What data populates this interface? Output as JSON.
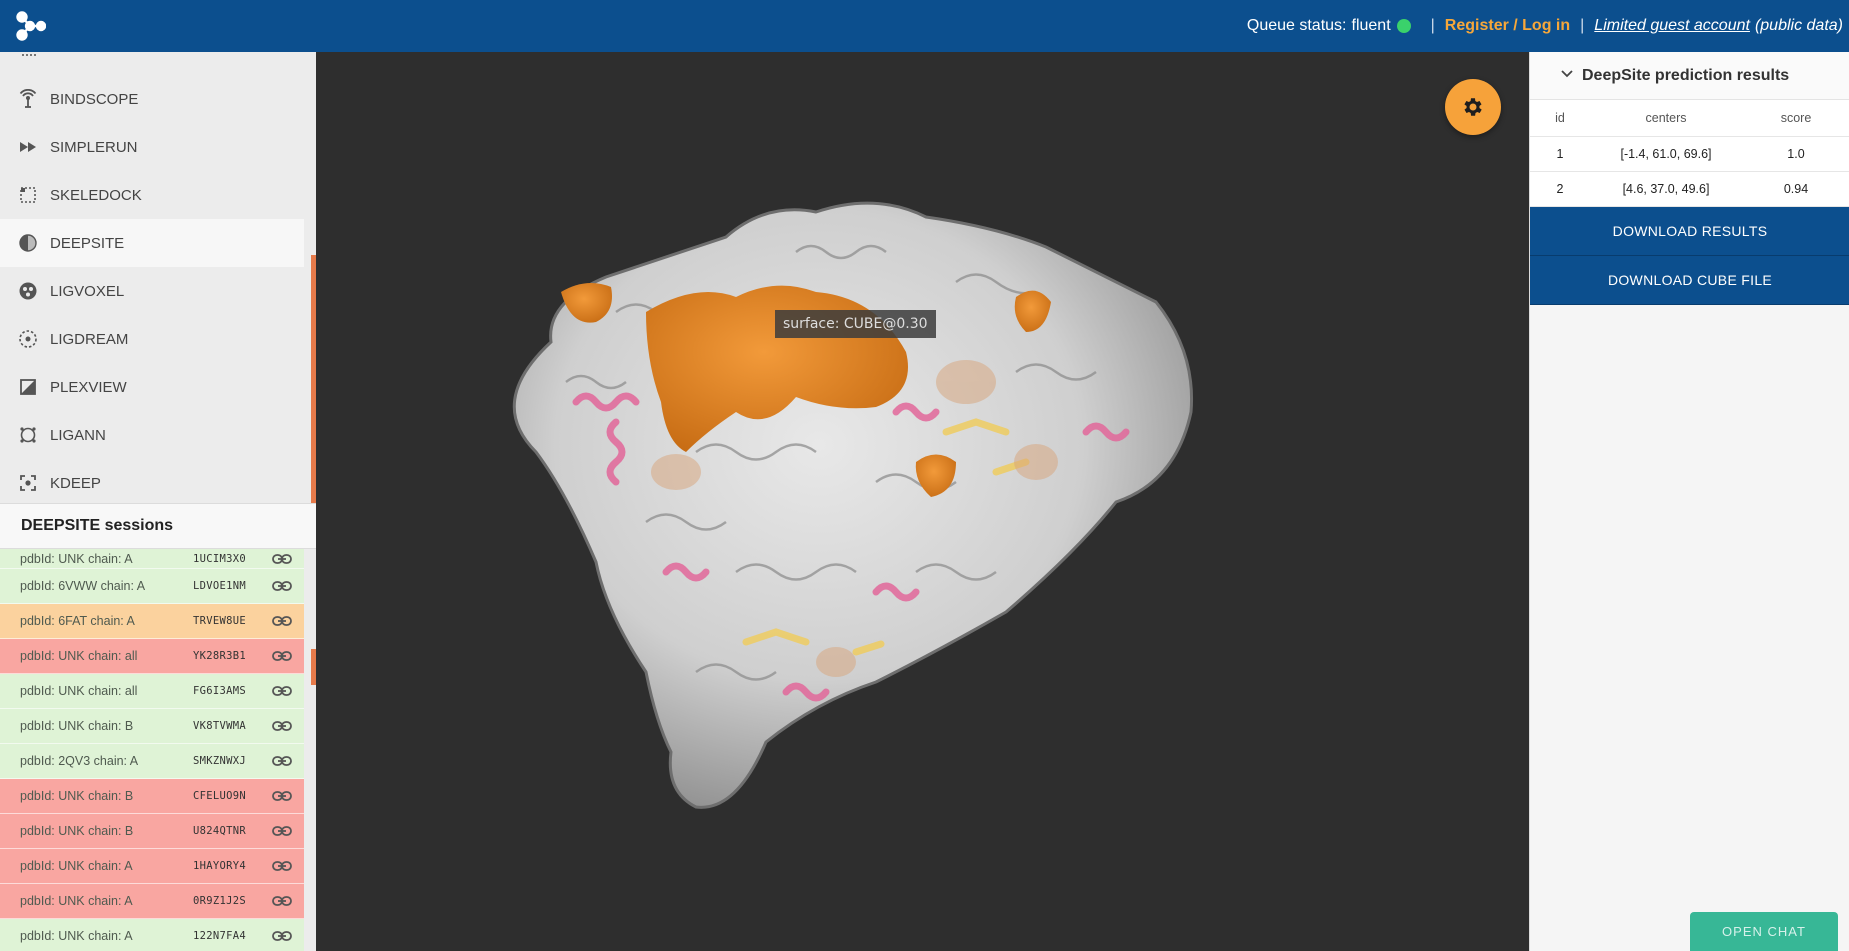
{
  "header": {
    "queue_label": "Queue status:",
    "queue_value": "fluent",
    "register_label": "Register / Log in",
    "guest_label": "Limited guest account",
    "guest_note": "(public data)",
    "separator": "|"
  },
  "sidebar": {
    "items": [
      {
        "label": "BINDSCOPE",
        "icon": "antenna-icon"
      },
      {
        "label": "SIMPLERUN",
        "icon": "fast-forward-icon"
      },
      {
        "label": "SKELEDOCK",
        "icon": "dotted-square-icon"
      },
      {
        "label": "DEEPSITE",
        "icon": "half-circle-icon",
        "active": true
      },
      {
        "label": "LIGVOXEL",
        "icon": "voxel-circle-icon"
      },
      {
        "label": "LIGDREAM",
        "icon": "dotted-circle-icon"
      },
      {
        "label": "PLEXVIEW",
        "icon": "plex-square-icon"
      },
      {
        "label": "LIGANN",
        "icon": "ring-icon"
      },
      {
        "label": "KDEEP",
        "icon": "target-square-icon"
      }
    ],
    "sessions_title": "DEEPSITE sessions",
    "sessions": [
      {
        "label": "pdbId: UNK chain: A",
        "code": "1UCIM3X0",
        "status": "ok"
      },
      {
        "label": "pdbId: 6VWW chain: A",
        "code": "LDVOE1NM",
        "status": "ok"
      },
      {
        "label": "pdbId: 6FAT chain: A",
        "code": "TRVEW8UE",
        "status": "run"
      },
      {
        "label": "pdbId: UNK chain: all",
        "code": "YK28R3B1",
        "status": "err"
      },
      {
        "label": "pdbId: UNK chain: all",
        "code": "FG6I3AMS",
        "status": "ok"
      },
      {
        "label": "pdbId: UNK chain: B",
        "code": "VK8TVWMA",
        "status": "ok"
      },
      {
        "label": "pdbId: 2QV3 chain: A",
        "code": "SMKZNWXJ",
        "status": "ok"
      },
      {
        "label": "pdbId: UNK chain: B",
        "code": "CFELUO9N",
        "status": "err"
      },
      {
        "label": "pdbId: UNK chain: B",
        "code": "U824QTNR",
        "status": "err"
      },
      {
        "label": "pdbId: UNK chain: A",
        "code": "1HAYORY4",
        "status": "err"
      },
      {
        "label": "pdbId: UNK chain: A",
        "code": "0R9Z1J2S",
        "status": "err"
      },
      {
        "label": "pdbId: UNK chain: A",
        "code": "122N7FA4",
        "status": "ok"
      }
    ]
  },
  "viewer": {
    "tooltip": "surface: CUBE@0.30"
  },
  "results_panel": {
    "title": "DeepSite prediction results",
    "columns": [
      "id",
      "centers",
      "score"
    ],
    "rows": [
      {
        "id": "1",
        "centers": "[-1.4, 61.0, 69.6]",
        "score": "1.0"
      },
      {
        "id": "2",
        "centers": "[4.6, 37.0, 49.6]",
        "score": "0.94"
      }
    ],
    "download_results": "DOWNLOAD RESULTS",
    "download_cube": "DOWNLOAD CUBE FILE"
  },
  "chat": {
    "label": "OPEN CHAT"
  },
  "colors": {
    "brand_blue": "#0c4f8e",
    "accent_orange": "#f6a23a",
    "status_green": "#3ad26b",
    "session_ok": "#dff3d6",
    "session_error": "#f9a6a1",
    "session_running": "#fbd29e",
    "chat_green": "#37b796"
  }
}
